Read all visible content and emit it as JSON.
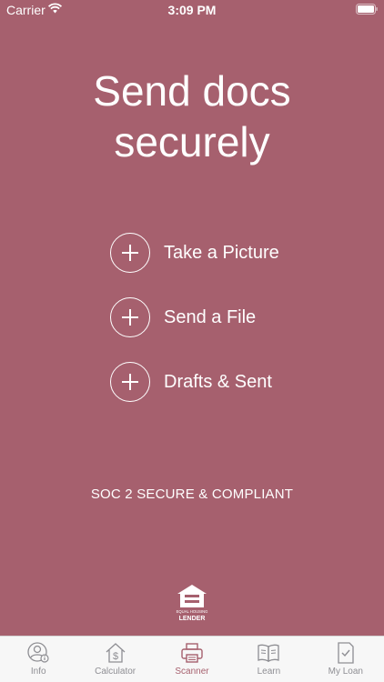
{
  "status": {
    "carrier": "Carrier",
    "time": "3:09 PM"
  },
  "main": {
    "title_line1": "Send docs",
    "title_line2": "securely",
    "actions": [
      {
        "label": "Take a Picture",
        "icon": "plus-circle-icon"
      },
      {
        "label": "Send a File",
        "icon": "plus-circle-icon"
      },
      {
        "label": "Drafts & Sent",
        "icon": "plus-circle-icon"
      }
    ],
    "compliance_text": "SOC 2 SECURE & COMPLIANT",
    "logo_text": {
      "top": "EQUAL HOUSING",
      "bottom": "LENDER"
    }
  },
  "tabbar": {
    "tabs": [
      {
        "label": "Info",
        "icon": "person-info-icon",
        "active": false
      },
      {
        "label": "Calculator",
        "icon": "house-dollar-icon",
        "active": false
      },
      {
        "label": "Scanner",
        "icon": "printer-icon",
        "active": true
      },
      {
        "label": "Learn",
        "icon": "book-icon",
        "active": false
      },
      {
        "label": "My Loan",
        "icon": "document-check-icon",
        "active": false
      }
    ]
  },
  "colors": {
    "background": "#a6606e",
    "accent": "#a6606e",
    "tab_inactive": "#8e8e93"
  }
}
